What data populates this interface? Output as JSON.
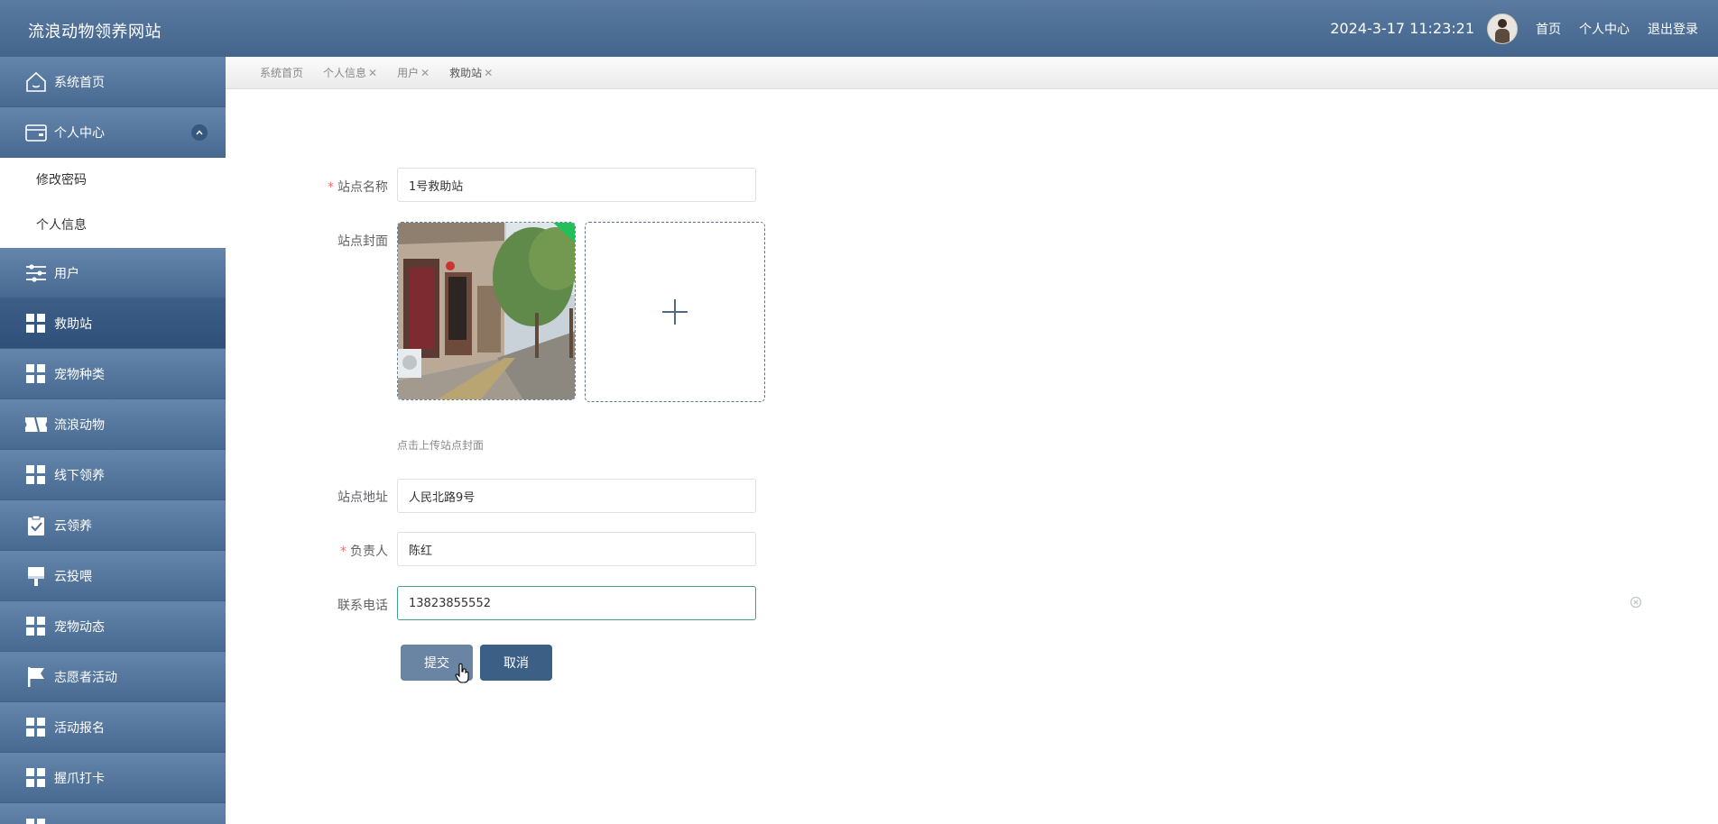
{
  "header": {
    "site_title": "流浪动物领养网站",
    "datetime": "2024-3-17 11:23:21",
    "link_home": "首页",
    "link_profile": "个人中心",
    "link_logout": "退出登录",
    "color": "#4b6c93"
  },
  "sidebar": {
    "items": [
      {
        "label": "系统首页",
        "icon": "home-icon"
      },
      {
        "label": "个人中心",
        "icon": "wallet-icon",
        "expanded": true
      },
      {
        "label": "用户",
        "icon": "sliders-icon"
      },
      {
        "label": "救助站",
        "icon": "grid-icon",
        "active": true
      },
      {
        "label": "宠物种类",
        "icon": "grid-icon"
      },
      {
        "label": "流浪动物",
        "icon": "ticket-icon"
      },
      {
        "label": "线下领养",
        "icon": "grid-icon"
      },
      {
        "label": "云领养",
        "icon": "clipboard-check-icon"
      },
      {
        "label": "云投喂",
        "icon": "brush-icon"
      },
      {
        "label": "宠物动态",
        "icon": "grid-icon"
      },
      {
        "label": "志愿者活动",
        "icon": "flag-icon"
      },
      {
        "label": "活动报名",
        "icon": "grid-icon"
      },
      {
        "label": "握爪打卡",
        "icon": "grid-icon"
      }
    ],
    "submenu": [
      "修改密码",
      "个人信息"
    ]
  },
  "tabs": [
    {
      "label": "系统首页",
      "closable": false
    },
    {
      "label": "个人信息",
      "closable": true
    },
    {
      "label": "用户",
      "closable": true
    },
    {
      "label": "救助站",
      "closable": true,
      "current": true
    }
  ],
  "form": {
    "station_name": {
      "label": "站点名称",
      "value": "1号救助站",
      "required": true
    },
    "cover": {
      "label": "站点封面",
      "tip": "点击上传站点封面"
    },
    "address": {
      "label": "站点地址",
      "value": "人民北路9号"
    },
    "manager": {
      "label": "负责人",
      "value": "陈红",
      "required": true
    },
    "phone": {
      "label": "联系电话",
      "value": "13823855552"
    },
    "submit_label": "提交",
    "cancel_label": "取消",
    "required_mark": "*"
  }
}
